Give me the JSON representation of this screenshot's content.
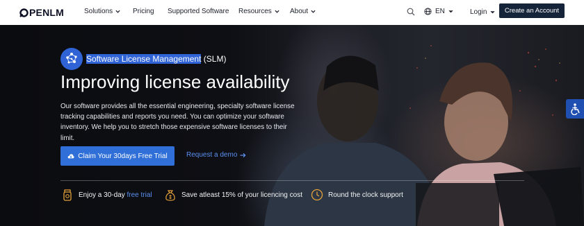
{
  "nav": {
    "brand": "PENLM",
    "items": [
      {
        "label": "Solutions",
        "has_menu": true
      },
      {
        "label": "Pricing",
        "has_menu": false
      },
      {
        "label": "Supported Software",
        "has_menu": false
      },
      {
        "label": "Resources",
        "has_menu": true
      },
      {
        "label": "About",
        "has_menu": true
      }
    ],
    "language": "EN",
    "login": "Login",
    "cta": "Create an Account"
  },
  "hero": {
    "tag_highlight": "Software License Management",
    "tag_rest": " (SLM)",
    "headline": "Improving license availability",
    "description": "Our software provides all the essential engineering, specialty software license tracking capabilities and reports you need. You can optimize your software inventory. We help you to stretch those expensive software licenses to their limit.",
    "trial_button": "Claim Your 30days Free Trial",
    "demo_link": "Request a demo"
  },
  "features": [
    {
      "icon": "coin-jar-icon",
      "text": "Enjoy a 30-day ",
      "link": "free trial"
    },
    {
      "icon": "money-bag-icon",
      "text": "Save atleast 15% of your licencing cost"
    },
    {
      "icon": "clock-support-icon",
      "text": "Round the clock support"
    }
  ],
  "colors": {
    "accent": "#2f6fd7",
    "nav_cta": "#16243a",
    "icon_gold": "#e5a23a",
    "link": "#5b8ff0"
  }
}
